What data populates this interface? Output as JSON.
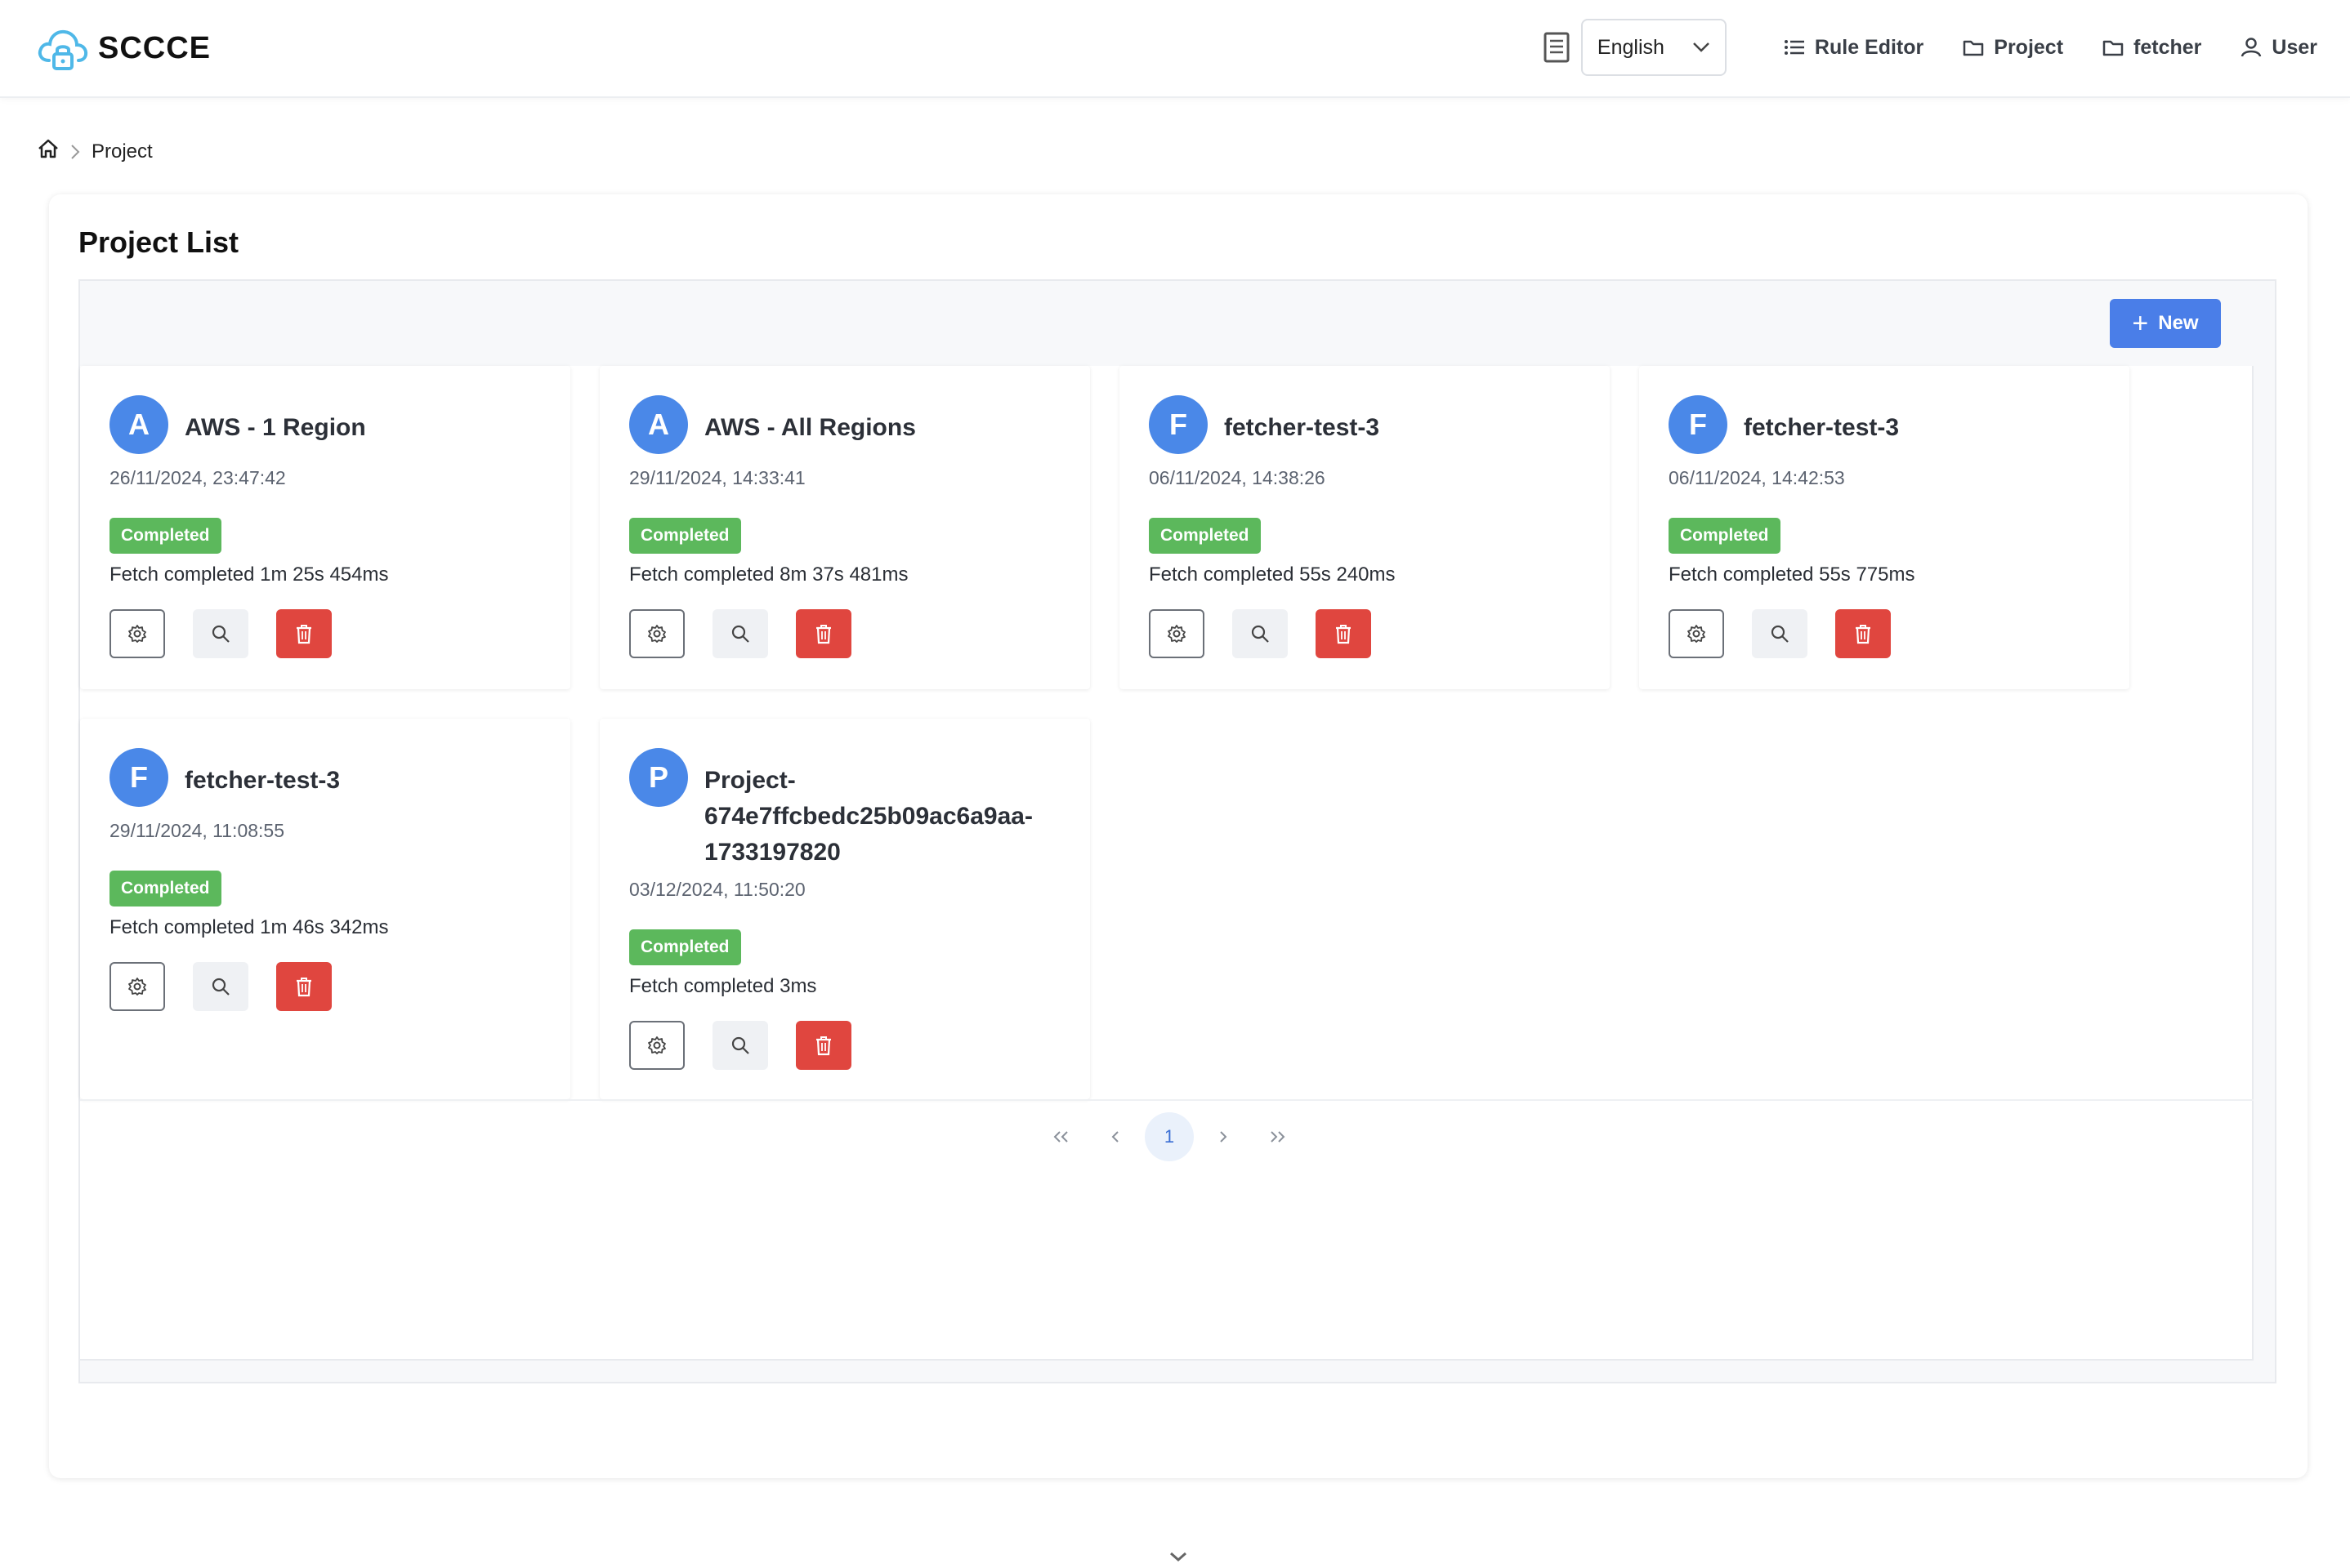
{
  "app": {
    "name": "SCCCE"
  },
  "header": {
    "language": "English",
    "nav": [
      {
        "label": "Rule Editor",
        "icon": "list-icon"
      },
      {
        "label": "Project",
        "icon": "folder-icon"
      },
      {
        "label": "fetcher",
        "icon": "folder-icon"
      },
      {
        "label": "User",
        "icon": "user-icon"
      }
    ]
  },
  "breadcrumb": {
    "current": "Project"
  },
  "page": {
    "title": "Project List",
    "new_label": "New"
  },
  "projects": [
    {
      "initial": "A",
      "name": "AWS - 1 Region",
      "date": "26/11/2024, 23:47:42",
      "status": "Completed",
      "message": "Fetch completed 1m 25s 454ms"
    },
    {
      "initial": "A",
      "name": "AWS - All Regions",
      "date": "29/11/2024, 14:33:41",
      "status": "Completed",
      "message": "Fetch completed 8m 37s 481ms"
    },
    {
      "initial": "F",
      "name": "fetcher-test-3",
      "date": "06/11/2024, 14:38:26",
      "status": "Completed",
      "message": "Fetch completed 55s 240ms"
    },
    {
      "initial": "F",
      "name": "fetcher-test-3",
      "date": "06/11/2024, 14:42:53",
      "status": "Completed",
      "message": "Fetch completed 55s 775ms"
    },
    {
      "initial": "F",
      "name": "fetcher-test-3",
      "date": "29/11/2024, 11:08:55",
      "status": "Completed",
      "message": "Fetch completed 1m 46s 342ms"
    },
    {
      "initial": "P",
      "name": "Project-674e7ffcbedc25b09ac6a9aa-1733197820",
      "date": "03/12/2024, 11:50:20",
      "status": "Completed",
      "message": "Fetch completed 3ms"
    }
  ],
  "pagination": {
    "current_page": "1"
  },
  "colors": {
    "primary": "#4a7ee8",
    "avatar": "#4a88e8",
    "success": "#5cb85c",
    "danger": "#e0463f"
  }
}
